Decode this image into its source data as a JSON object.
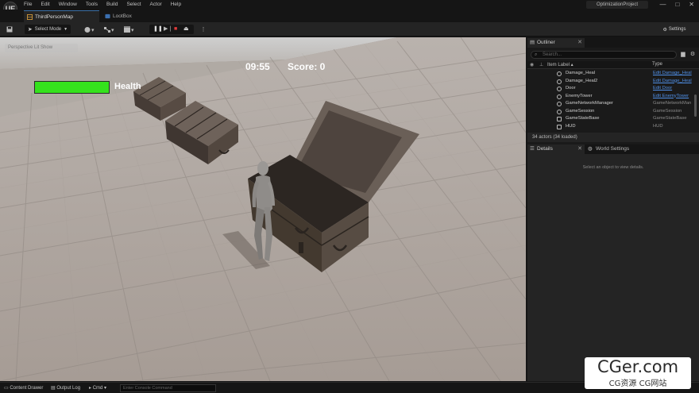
{
  "app": {
    "logo": "UE",
    "menu": [
      "File",
      "Edit",
      "Window",
      "Tools",
      "Build",
      "Select",
      "Actor",
      "Help"
    ],
    "project_name": "OptimizationProject",
    "window_controls": [
      "—",
      "□",
      "✕"
    ]
  },
  "tabs": [
    {
      "label": "ThirdPersonMap",
      "active": true,
      "icon": "level-icon"
    },
    {
      "label": "LootBox",
      "active": false,
      "icon": "blueprint-icon"
    }
  ],
  "toolbar": {
    "save_icon": "save-icon",
    "select_mode_label": "Select Mode",
    "settings_label": "Settings"
  },
  "viewport": {
    "perspective_chip": "Perspective  Lit  Show",
    "hud": {
      "timer": "09:55",
      "score": "Score: 0",
      "health_label": "Health",
      "health_fraction": 1.0,
      "health_color": "#35e21d"
    }
  },
  "outliner": {
    "tab_label": "Outliner",
    "search_placeholder": "Search...",
    "col_item_label": "Item Label ▴",
    "col_type": "Type",
    "rows": [
      {
        "name": "Damage_Heal",
        "type": "Edit Damage_Heal",
        "link": true,
        "icon": "actor-icon"
      },
      {
        "name": "Damage_Heal2",
        "type": "Edit Damage_Heal",
        "link": true,
        "icon": "actor-icon"
      },
      {
        "name": "Door",
        "type": "Edit Door",
        "link": true,
        "icon": "actor-icon"
      },
      {
        "name": "EnemyTower",
        "type": "Edit EnemyTower",
        "link": true,
        "icon": "actor-icon"
      },
      {
        "name": "GameNetworkManager",
        "type": "GameNetworkMan",
        "link": false,
        "icon": "actor-icon"
      },
      {
        "name": "GameSession",
        "type": "GameSession",
        "link": false,
        "icon": "actor-icon"
      },
      {
        "name": "GameStateBase",
        "type": "GameStateBase",
        "link": false,
        "icon": "info-icon"
      },
      {
        "name": "HUD",
        "type": "HUD",
        "link": false,
        "icon": "hud-icon"
      }
    ],
    "actor_count": "34 actors (34 loaded)"
  },
  "details": {
    "tab_label": "Details",
    "world_settings_label": "World Settings",
    "empty_message": "Select an object to view details."
  },
  "statusbar": {
    "content_drawer": "Content Drawer",
    "output_log": "Output Log",
    "cmd": "Cmd ▾",
    "console_placeholder": "Enter Console Command"
  },
  "watermark": {
    "main": "CGer.com",
    "sub": "CG资源 CG网站"
  }
}
